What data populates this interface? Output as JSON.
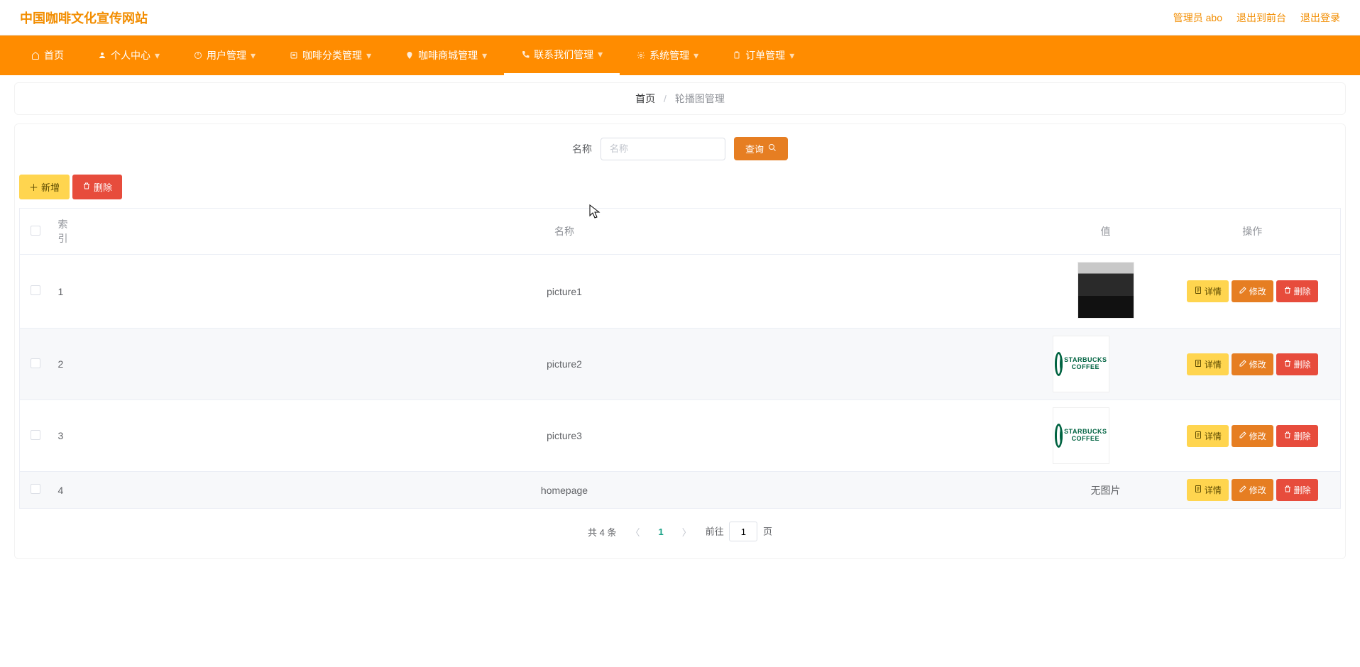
{
  "header": {
    "site_title": "中国咖啡文化宣传网站",
    "admin_label": "管理员 abo",
    "to_front_label": "退出到前台",
    "logout_label": "退出登录"
  },
  "nav": {
    "items": [
      {
        "label": "首页",
        "icon": "home-icon",
        "dropdown": false
      },
      {
        "label": "个人中心",
        "icon": "user-icon",
        "dropdown": true
      },
      {
        "label": "用户管理",
        "icon": "power-icon",
        "dropdown": true
      },
      {
        "label": "咖啡分类管理",
        "icon": "list-icon",
        "dropdown": true
      },
      {
        "label": "咖啡商城管理",
        "icon": "location-icon",
        "dropdown": true
      },
      {
        "label": "联系我们管理",
        "icon": "phone-icon",
        "dropdown": true,
        "active": true
      },
      {
        "label": "系统管理",
        "icon": "gear-icon",
        "dropdown": true
      },
      {
        "label": "订单管理",
        "icon": "clipboard-icon",
        "dropdown": true
      }
    ]
  },
  "breadcrumb": {
    "home": "首页",
    "current": "轮播图管理"
  },
  "search": {
    "label": "名称",
    "placeholder": "名称",
    "button": "查询"
  },
  "toolbar": {
    "add_label": "新增",
    "delete_label": "删除"
  },
  "table": {
    "headers": {
      "index": "索引",
      "name": "名称",
      "value": "值",
      "ops": "操作"
    },
    "no_image": "无图片",
    "row_buttons": {
      "detail": "详情",
      "edit": "修改",
      "delete": "删除"
    },
    "rows": [
      {
        "idx": "1",
        "name": "picture1",
        "thumb": "dark"
      },
      {
        "idx": "2",
        "name": "picture2",
        "thumb": "starbucks"
      },
      {
        "idx": "3",
        "name": "picture3",
        "thumb": "starbucks"
      },
      {
        "idx": "4",
        "name": "homepage",
        "thumb": "none"
      }
    ]
  },
  "pagination": {
    "total_text": "共 4 条",
    "current": "1",
    "jump_prefix": "前往",
    "jump_value": "1",
    "jump_suffix": "页"
  }
}
